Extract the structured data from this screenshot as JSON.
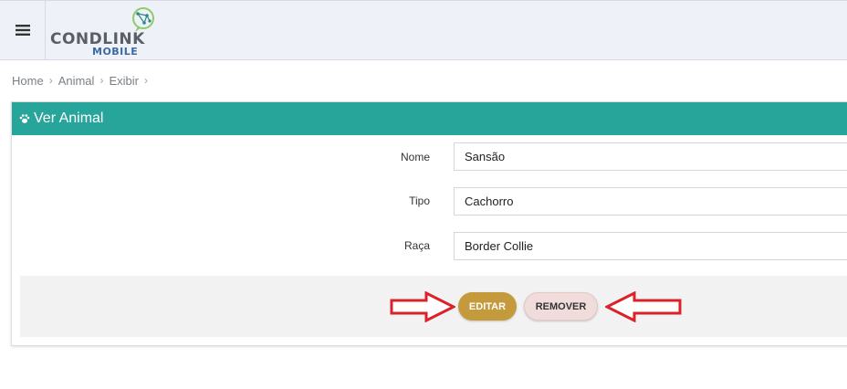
{
  "header": {
    "logo_text": "CONDLINK",
    "logo_sub": "MOBILE"
  },
  "breadcrumb": [
    "Home",
    "Animal",
    "Exibir"
  ],
  "panel": {
    "title": "Ver Animal",
    "fields": [
      {
        "label": "Nome",
        "value": "Sansão"
      },
      {
        "label": "Tipo",
        "value": "Cachorro"
      },
      {
        "label": "Raça",
        "value": "Border Collie"
      }
    ]
  },
  "actions": {
    "edit_label": "EDITAR",
    "remove_label": "REMOVER"
  },
  "colors": {
    "header_bg": "#eef2f8",
    "panel_header": "#27a59a",
    "edit_button": "#c49a3c",
    "remove_button": "#f1dcdc",
    "arrow": "#d9222a"
  }
}
